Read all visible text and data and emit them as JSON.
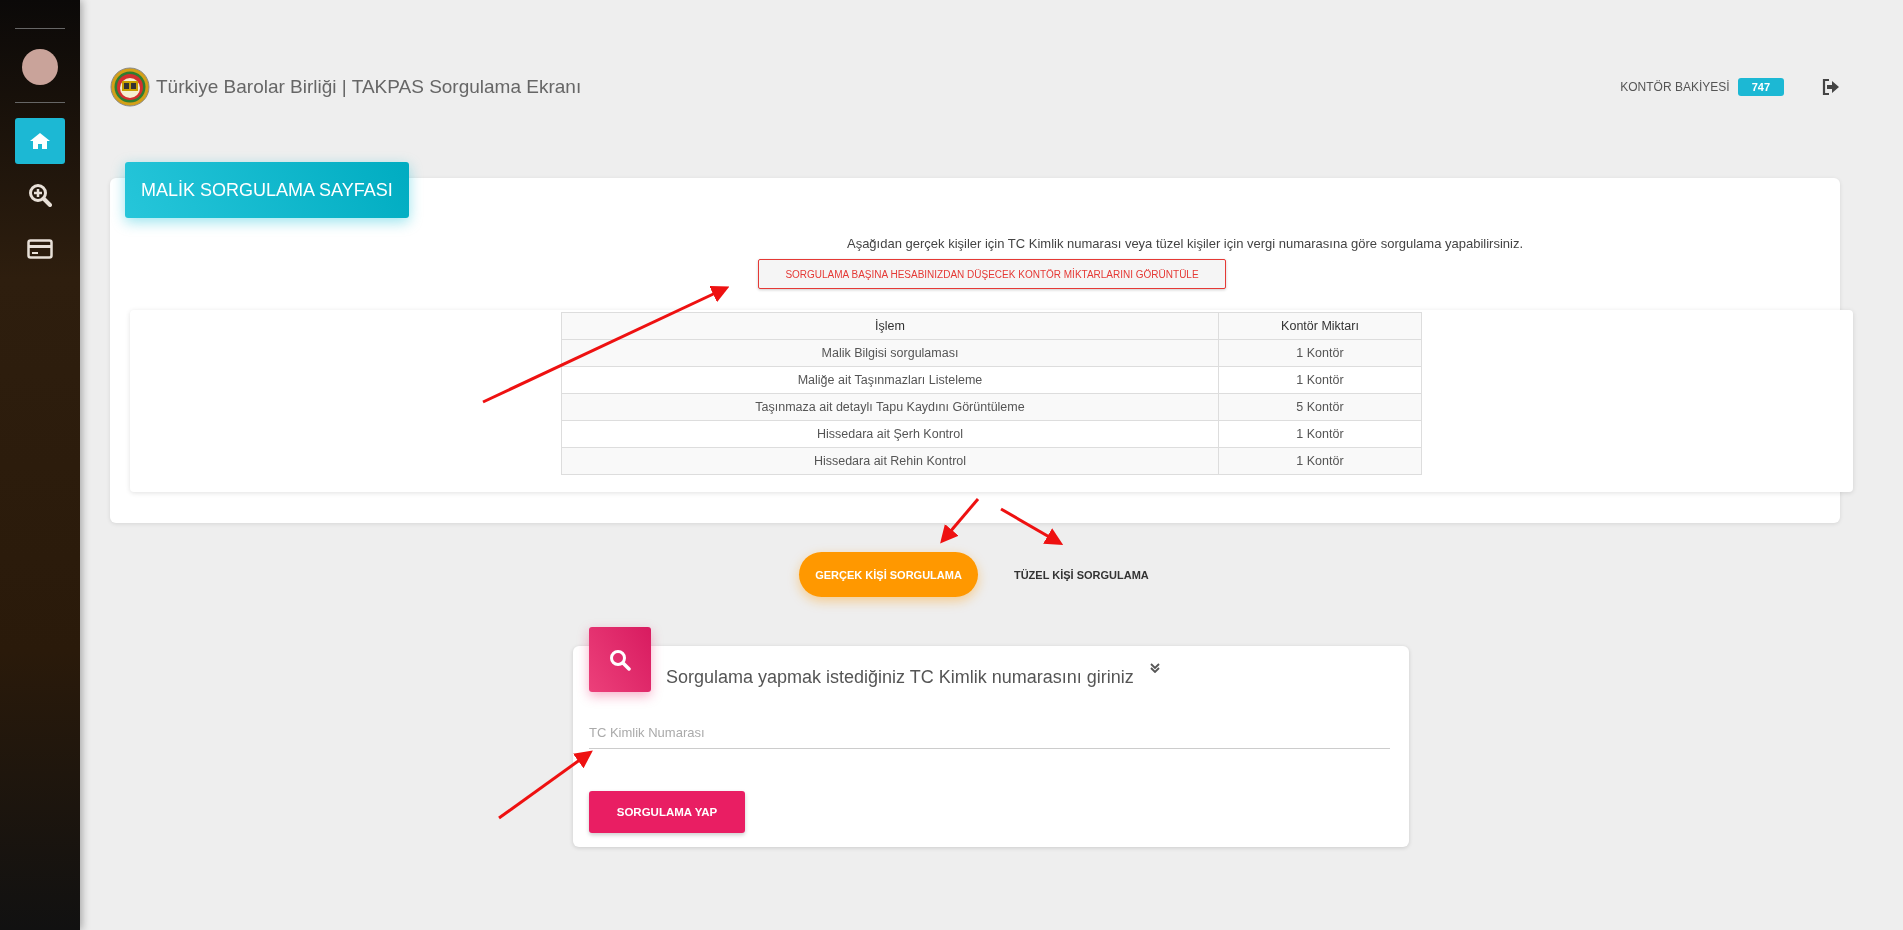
{
  "header": {
    "title": "Türkiye Barolar Birliği | TAKPAS Sorgulama Ekranı",
    "balance_label": "KONTÖR BAKİYESİ",
    "balance_value": "747"
  },
  "sidebar": {
    "items": [
      {
        "kind": "home",
        "selected": true
      },
      {
        "kind": "search",
        "selected": false
      },
      {
        "kind": "card",
        "selected": false
      }
    ]
  },
  "query_card": {
    "title": "MALİK SORGULAMA SAYFASI",
    "description": "Aşağıdan gerçek kişiler için TC Kimlik numarası veya tüzel kişiler için vergi numarasına göre sorgulama yapabilirsiniz.",
    "fee_button": "SORGULAMA BAŞINA HESABINIZDAN DÜŞECEK KONTÖR MİKTARLARINI GÖRÜNTÜLE",
    "table": {
      "columns": [
        "İşlem",
        "Kontör Miktarı"
      ],
      "rows": [
        [
          "Malik Bilgisi sorgulaması",
          "1 Kontör"
        ],
        [
          "Maliğe ait Taşınmazları Listeleme",
          "1 Kontör"
        ],
        [
          "Taşınmaza ait detaylı Tapu Kaydını Görüntüleme",
          "5 Kontör"
        ],
        [
          "Hissedara ait Şerh Kontrol",
          "1 Kontör"
        ],
        [
          "Hissedara ait Rehin Kontrol",
          "1 Kontör"
        ]
      ]
    }
  },
  "tabs": [
    {
      "label": "GERÇEK KİŞİ SORGULAMA",
      "selected": true
    },
    {
      "label": "TÜZEL KİŞİ SORGULAMA",
      "selected": false
    }
  ],
  "search_panel": {
    "title": "Sorgulama yapmak istediğiniz TC Kimlik numarasını giriniz",
    "placeholder": "TC Kimlik Numarası",
    "submit": "SORGULAMA YAP"
  }
}
